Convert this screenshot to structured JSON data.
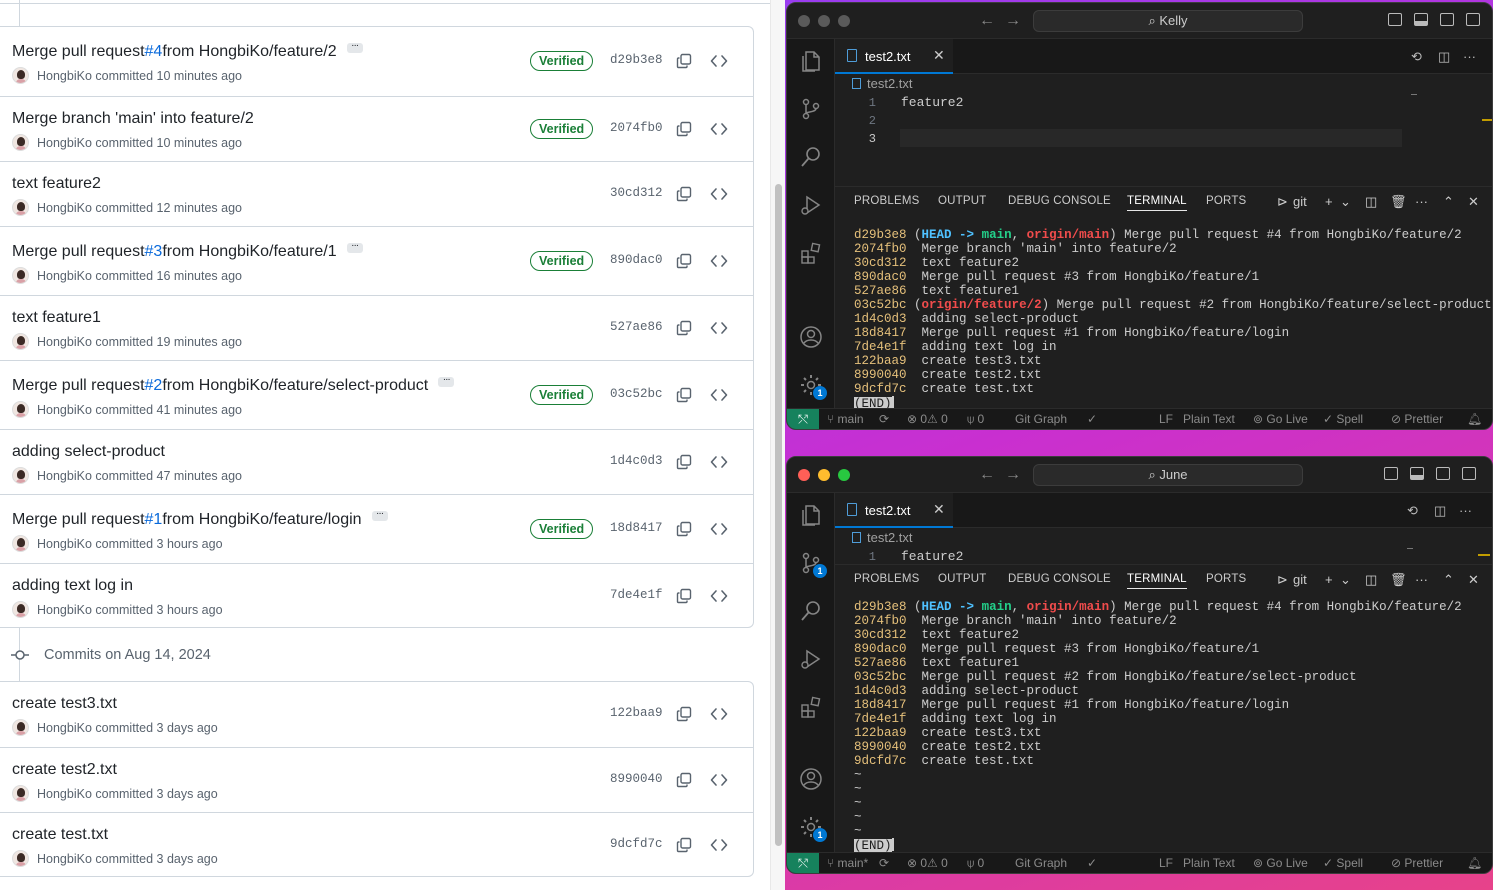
{
  "github": {
    "commits_top": [
      {
        "msg_pre": "Merge pull request ",
        "pr": "#4",
        "msg_post": " from HongbiKo/feature/2",
        "more": "···",
        "author": "HongbiKo",
        "time": "committed 10 minutes ago",
        "verified": "Verified",
        "sha": "d29b3e8"
      },
      {
        "msg_pre": "Merge branch 'main' into feature/2",
        "pr": "",
        "msg_post": "",
        "more": "",
        "author": "HongbiKo",
        "time": "committed 10 minutes ago",
        "verified": "Verified",
        "sha": "2074fb0"
      },
      {
        "msg_pre": "text feature2",
        "pr": "",
        "msg_post": "",
        "more": "",
        "author": "HongbiKo",
        "time": "committed 12 minutes ago",
        "verified": "",
        "sha": "30cd312"
      },
      {
        "msg_pre": "Merge pull request ",
        "pr": "#3",
        "msg_post": " from HongbiKo/feature/1",
        "more": "···",
        "author": "HongbiKo",
        "time": "committed 16 minutes ago",
        "verified": "Verified",
        "sha": "890dac0"
      },
      {
        "msg_pre": "text feature1",
        "pr": "",
        "msg_post": "",
        "more": "",
        "author": "HongbiKo",
        "time": "committed 19 minutes ago",
        "verified": "",
        "sha": "527ae86"
      },
      {
        "msg_pre": "Merge pull request ",
        "pr": "#2",
        "msg_post": " from HongbiKo/feature/select-product",
        "more": "···",
        "author": "HongbiKo",
        "time": "committed 41 minutes ago",
        "verified": "Verified",
        "sha": "03c52bc"
      },
      {
        "msg_pre": "adding select-product",
        "pr": "",
        "msg_post": "",
        "more": "",
        "author": "HongbiKo",
        "time": "committed 47 minutes ago",
        "verified": "",
        "sha": "1d4c0d3"
      },
      {
        "msg_pre": "Merge pull request ",
        "pr": "#1",
        "msg_post": " from HongbiKo/feature/login",
        "more": "···",
        "author": "HongbiKo",
        "time": "committed 3 hours ago",
        "verified": "Verified",
        "sha": "18d8417"
      },
      {
        "msg_pre": "adding text log in",
        "pr": "",
        "msg_post": "",
        "more": "",
        "author": "HongbiKo",
        "time": "committed 3 hours ago",
        "verified": "",
        "sha": "7de4e1f"
      }
    ],
    "date_header": "Commits on Aug 14, 2024",
    "commits_bottom": [
      {
        "msg_pre": "create test3.txt",
        "author": "HongbiKo",
        "time": "committed 3 days ago",
        "sha": "122baa9"
      },
      {
        "msg_pre": "create test2.txt",
        "author": "HongbiKo",
        "time": "committed 3 days ago",
        "sha": "8990040"
      },
      {
        "msg_pre": "create test.txt",
        "author": "HongbiKo",
        "time": "committed 3 days ago",
        "sha": "9dcfd7c"
      }
    ]
  },
  "vscode_top": {
    "search": "Kelly",
    "tab": "test2.txt",
    "close": "✕",
    "breadcrumb": "test2.txt",
    "lines": [
      "feature2",
      "",
      ""
    ],
    "panel_tabs": [
      "PROBLEMS",
      "OUTPUT",
      "DEBUG CONSOLE",
      "TERMINAL",
      "PORTS"
    ],
    "shell": "git",
    "scm_badge": "",
    "settings_badge": "1",
    "branch": "main",
    "errors": "0",
    "warnings": "0",
    "ports": "0",
    "status_items": [
      "Git Graph",
      "LF",
      "Plain Text",
      "Go Live",
      "Spell",
      "Prettier"
    ]
  },
  "vscode_bottom": {
    "search": "June",
    "tab": "test2.txt",
    "close": "✕",
    "breadcrumb": "test2.txt",
    "lines": [
      "feature2"
    ],
    "panel_tabs": [
      "PROBLEMS",
      "OUTPUT",
      "DEBUG CONSOLE",
      "TERMINAL",
      "PORTS"
    ],
    "shell": "git",
    "scm_badge": "1",
    "settings_badge": "1",
    "branch": "main*",
    "errors": "0",
    "warnings": "0",
    "ports": "0",
    "status_items": [
      "Git Graph",
      "LF",
      "Plain Text",
      "Go Live",
      "Spell",
      "Prettier"
    ]
  },
  "terminal_top": [
    {
      "hash": "d29b3e8",
      "refs": true,
      "remote": "origin/main",
      "text": " Merge pull request #4 from HongbiKo/feature/2"
    },
    {
      "hash": "2074fb0",
      "text": " Merge branch 'main' into feature/2"
    },
    {
      "hash": "30cd312",
      "text": " text feature2"
    },
    {
      "hash": "890dac0",
      "text": " Merge pull request #3 from HongbiKo/feature/1"
    },
    {
      "hash": "527ae86",
      "text": " text feature1"
    },
    {
      "hash": "03c52bc",
      "refonly": "origin/feature/2",
      "text": " Merge pull request #2 from HongbiKo/feature/select-product"
    },
    {
      "hash": "1d4c0d3",
      "text": " adding select-product"
    },
    {
      "hash": "18d8417",
      "text": " Merge pull request #1 from HongbiKo/feature/login"
    },
    {
      "hash": "7de4e1f",
      "text": " adding text log in"
    },
    {
      "hash": "122baa9",
      "text": " create test3.txt"
    },
    {
      "hash": "8990040",
      "text": " create test2.txt"
    },
    {
      "hash": "9dcfd7c",
      "text": " create test.txt"
    }
  ],
  "terminal_bottom": [
    {
      "hash": "d29b3e8",
      "refs": true,
      "remote": "origin/main",
      "text": " Merge pull request #4 from HongbiKo/feature/2"
    },
    {
      "hash": "2074fb0",
      "text": " Merge branch 'main' into feature/2"
    },
    {
      "hash": "30cd312",
      "text": " text feature2"
    },
    {
      "hash": "890dac0",
      "text": " Merge pull request #3 from HongbiKo/feature/1"
    },
    {
      "hash": "527ae86",
      "text": " text feature1"
    },
    {
      "hash": "03c52bc",
      "text": " Merge pull request #2 from HongbiKo/feature/select-product"
    },
    {
      "hash": "1d4c0d3",
      "text": " adding select-product"
    },
    {
      "hash": "18d8417",
      "text": " Merge pull request #1 from HongbiKo/feature/login"
    },
    {
      "hash": "7de4e1f",
      "text": " adding text log in"
    },
    {
      "hash": "122baa9",
      "text": " create test3.txt"
    },
    {
      "hash": "8990040",
      "text": " create test2.txt"
    },
    {
      "hash": "9dcfd7c",
      "text": " create test.txt"
    }
  ],
  "terminal_common": {
    "head": "HEAD",
    "arrow": " -> ",
    "branch": "main",
    "sep": ", ",
    "end": "(END)",
    "tilde": "~"
  },
  "colors": {
    "accent": "#0969da",
    "verified": "#1a7f37",
    "remote_indicator": "#16825d",
    "badge": "#0078d4",
    "hash": "#e5c07b"
  }
}
